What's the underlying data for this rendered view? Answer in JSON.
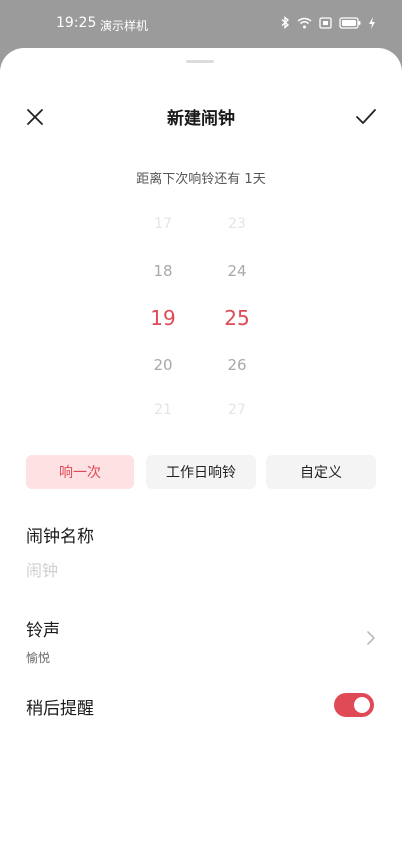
{
  "status_bar": {
    "time": "19:25",
    "carrier": "演示样机",
    "icons": [
      "bluetooth-icon",
      "wifi-icon",
      "sim-icon",
      "battery-icon",
      "charging-icon"
    ]
  },
  "sheet": {
    "title": "新建闹钟",
    "close_icon": "close-icon",
    "confirm_icon": "check-icon"
  },
  "countdown": "距离下次响铃还有 1天",
  "picker": {
    "hours": [
      "17",
      "18",
      "19",
      "20",
      "21"
    ],
    "minutes": [
      "23",
      "24",
      "25",
      "26",
      "27"
    ],
    "selected_hour": "19",
    "selected_minute": "25"
  },
  "repeat": {
    "options": [
      "响一次",
      "工作日响铃",
      "自定义"
    ],
    "selected": "响一次"
  },
  "alarm_name": {
    "label": "闹钟名称",
    "placeholder": "闹钟",
    "value": ""
  },
  "ringtone": {
    "label": "铃声",
    "value": "愉悦"
  },
  "snooze": {
    "label": "稍后提醒",
    "enabled": true
  },
  "colors": {
    "accent": "#e04a56",
    "selected_bg": "#fde1e3",
    "chip_bg": "#f4f4f4"
  }
}
